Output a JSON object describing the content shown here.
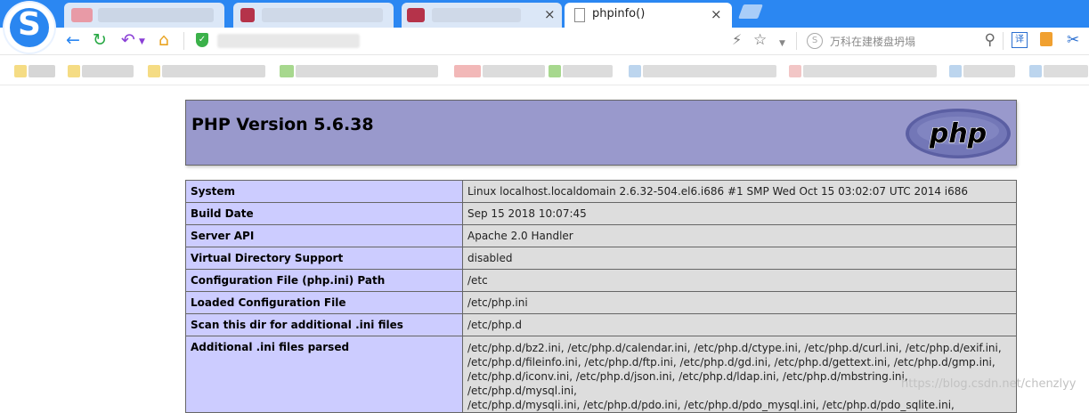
{
  "browser": {
    "active_tab": {
      "title": "phpinfo()"
    },
    "close_glyph": "×",
    "search_placeholder": "万科在建楼盘坍塌",
    "icons": [
      "back-icon",
      "reload-icon",
      "undo-icon",
      "home-icon",
      "shield-icon",
      "lightning-icon",
      "star-icon",
      "chevron-down-icon",
      "search-icon",
      "translate-icon",
      "extension-icon",
      "scissors-icon"
    ],
    "accent": "#2b87f2"
  },
  "phpinfo": {
    "version_title": "PHP Version 5.6.38",
    "logo_text": "php",
    "header_color": "#9999cc",
    "key_color": "#ccccff",
    "value_color": "#dddddd",
    "rows": [
      {
        "key": "System",
        "value": [
          "Linux localhost.localdomain 2.6.32-504.el6.i686 #1 SMP Wed Oct 15 03:02:07 UTC 2014 i686"
        ]
      },
      {
        "key": "Build Date",
        "value": [
          "Sep 15 2018 10:07:45"
        ]
      },
      {
        "key": "Server API",
        "value": [
          "Apache 2.0 Handler"
        ]
      },
      {
        "key": "Virtual Directory Support",
        "value": [
          "disabled"
        ]
      },
      {
        "key": "Configuration File (php.ini) Path",
        "value": [
          "/etc"
        ]
      },
      {
        "key": "Loaded Configuration File",
        "value": [
          "/etc/php.ini"
        ]
      },
      {
        "key": "Scan this dir for additional .ini files",
        "value": [
          "/etc/php.d"
        ]
      },
      {
        "key": "Additional .ini files parsed",
        "value": [
          "/etc/php.d/bz2.ini, /etc/php.d/calendar.ini, /etc/php.d/ctype.ini, /etc/php.d/curl.ini, /etc/php.d/exif.ini,",
          "/etc/php.d/fileinfo.ini, /etc/php.d/ftp.ini, /etc/php.d/gd.ini, /etc/php.d/gettext.ini, /etc/php.d/gmp.ini,",
          "/etc/php.d/iconv.ini, /etc/php.d/json.ini, /etc/php.d/ldap.ini, /etc/php.d/mbstring.ini, /etc/php.d/mysql.ini,",
          "/etc/php.d/mysqli.ini, /etc/php.d/pdo.ini, /etc/php.d/pdo_mysql.ini, /etc/php.d/pdo_sqlite.ini,"
        ]
      }
    ]
  },
  "watermark": "https://blog.csdn.net/chenzlyy"
}
